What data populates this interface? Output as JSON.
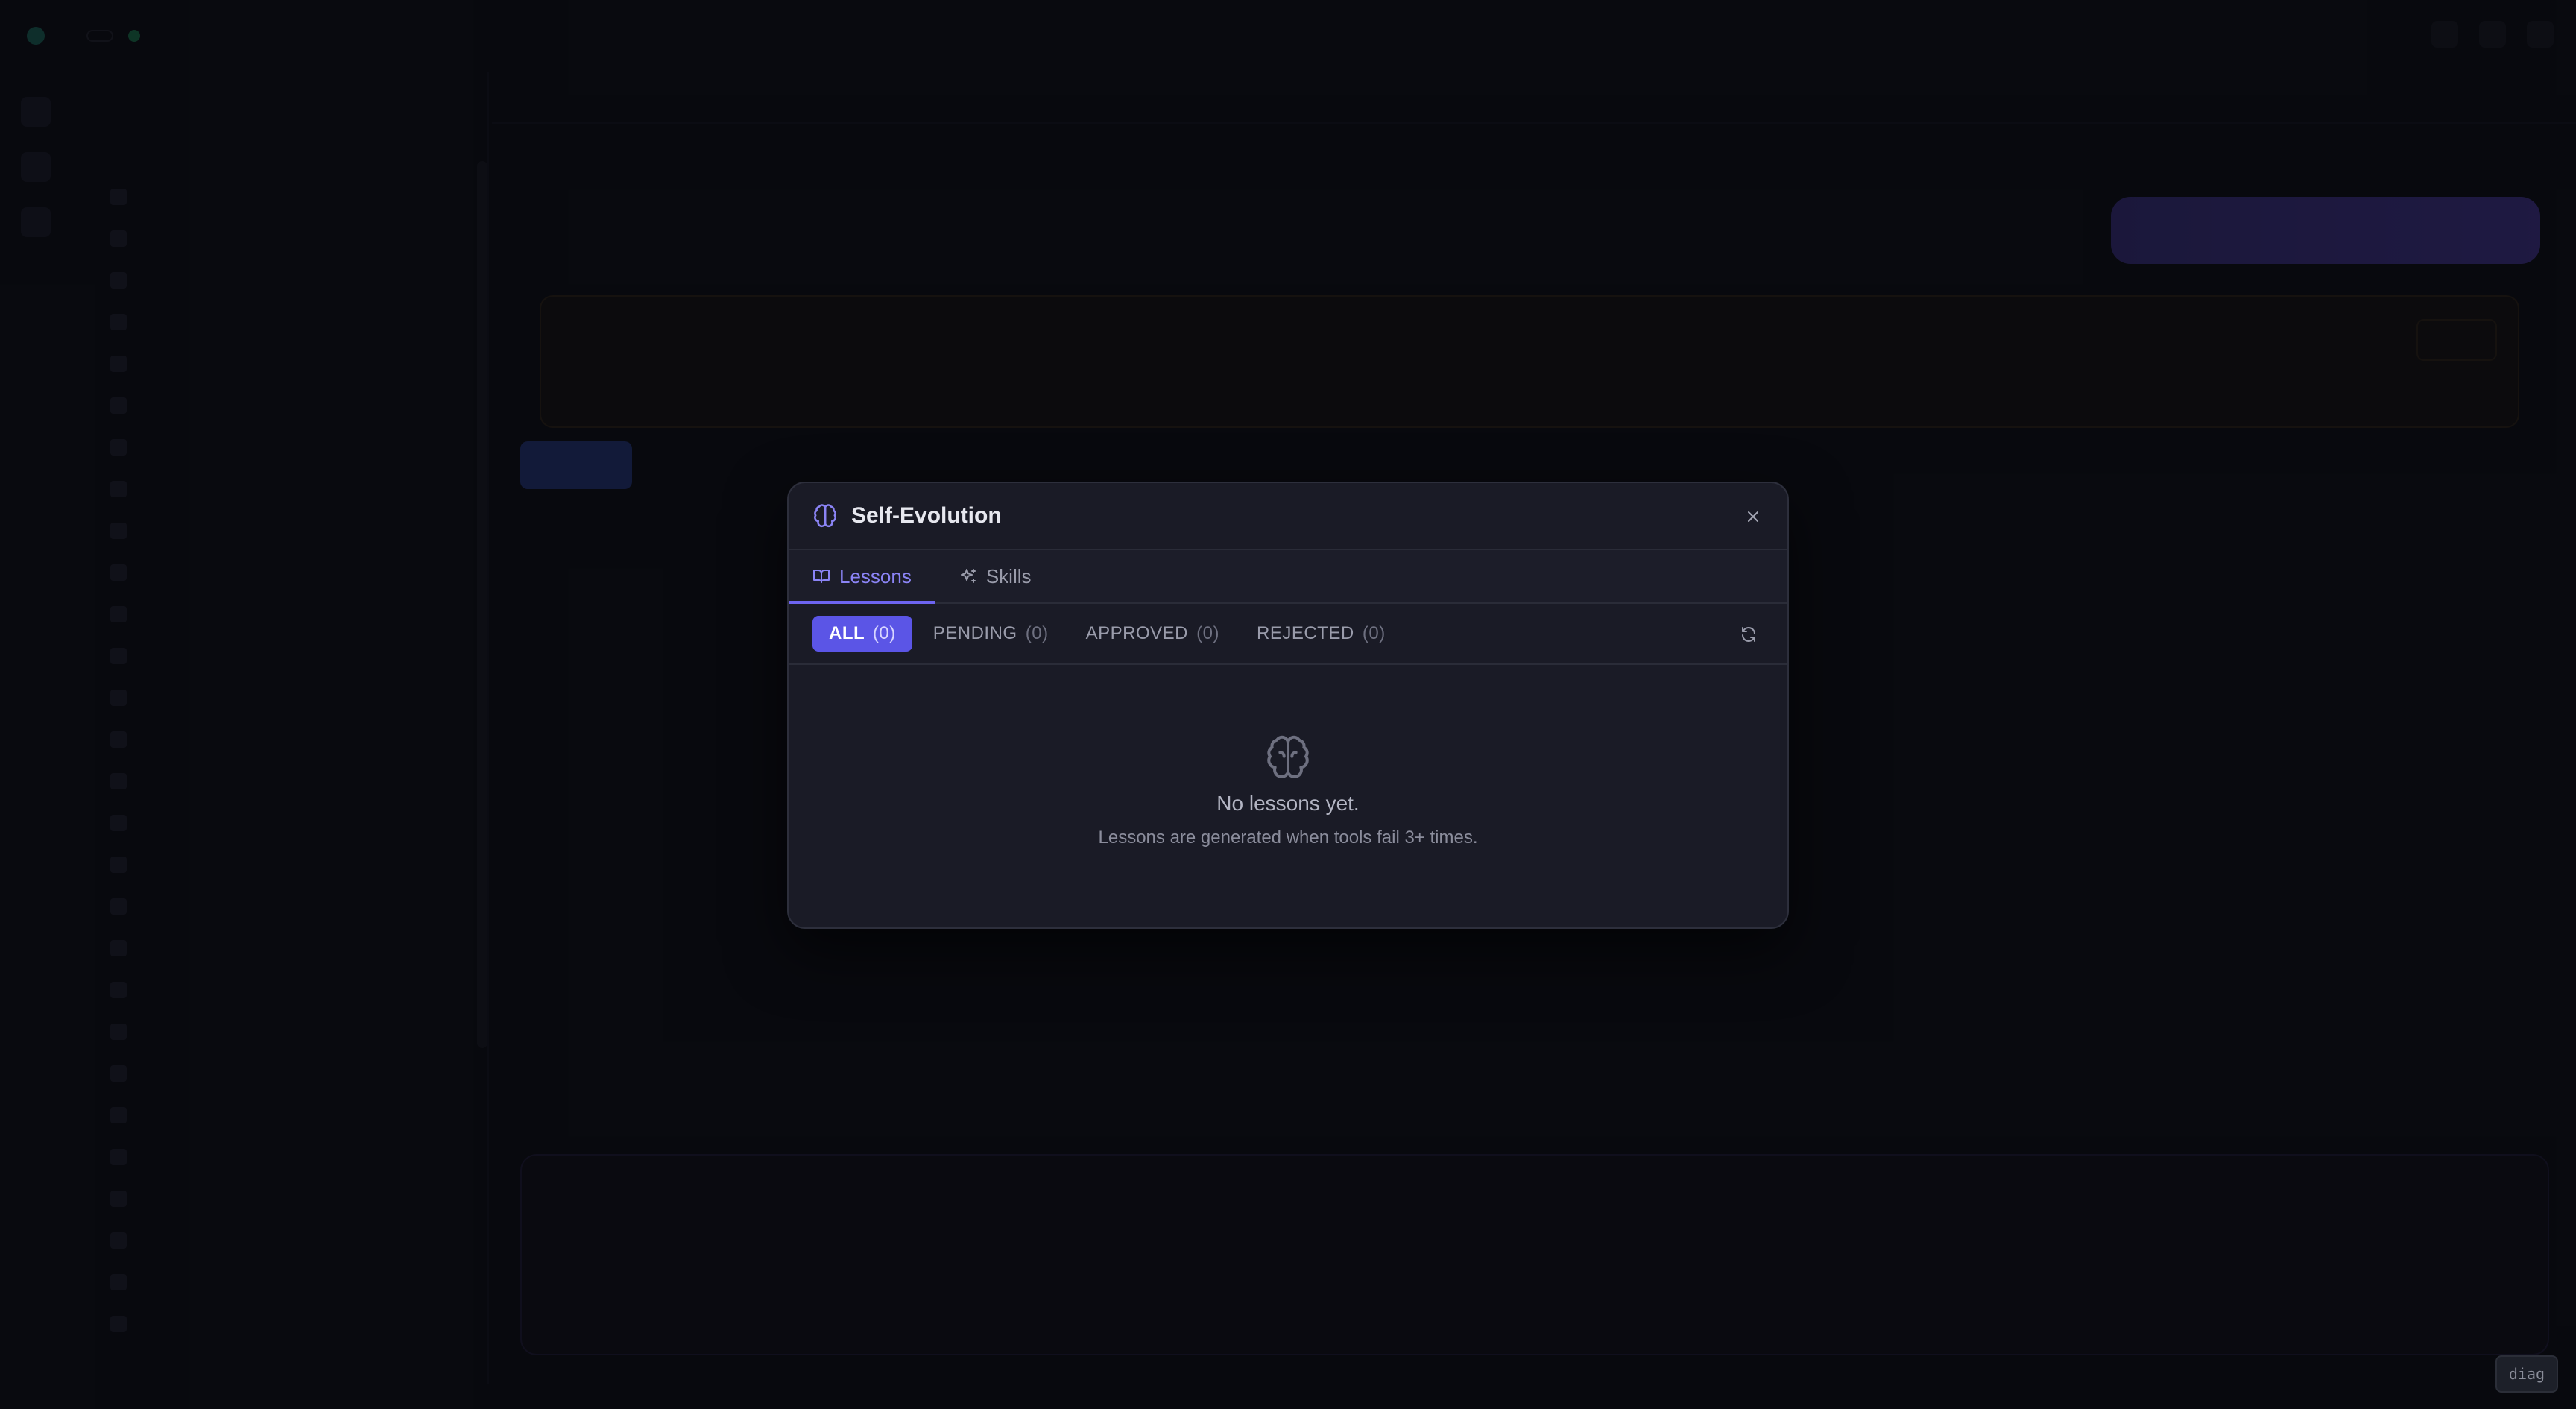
{
  "modal": {
    "title": "Self-Evolution",
    "tabs": [
      {
        "label": "Lessons",
        "icon": "book-icon",
        "active": true
      },
      {
        "label": "Skills",
        "icon": "sparkles-icon",
        "active": false
      }
    ],
    "filters": [
      {
        "label": "ALL",
        "count": "(0)",
        "active": true
      },
      {
        "label": "PENDING",
        "count": "(0)",
        "active": false
      },
      {
        "label": "APPROVED",
        "count": "(0)",
        "active": false
      },
      {
        "label": "REJECTED",
        "count": "(0)",
        "active": false
      }
    ],
    "empty_state": {
      "icon": "brain-icon",
      "title": "No lessons yet.",
      "subtitle": "Lessons are generated when tools fail 3+ times."
    }
  },
  "diag_label": "diag",
  "colors": {
    "accent": "#5b55e6",
    "tab_active": "#8b84f5",
    "modal_bg": "#1a1b26",
    "page_bg": "#0a0b10"
  }
}
